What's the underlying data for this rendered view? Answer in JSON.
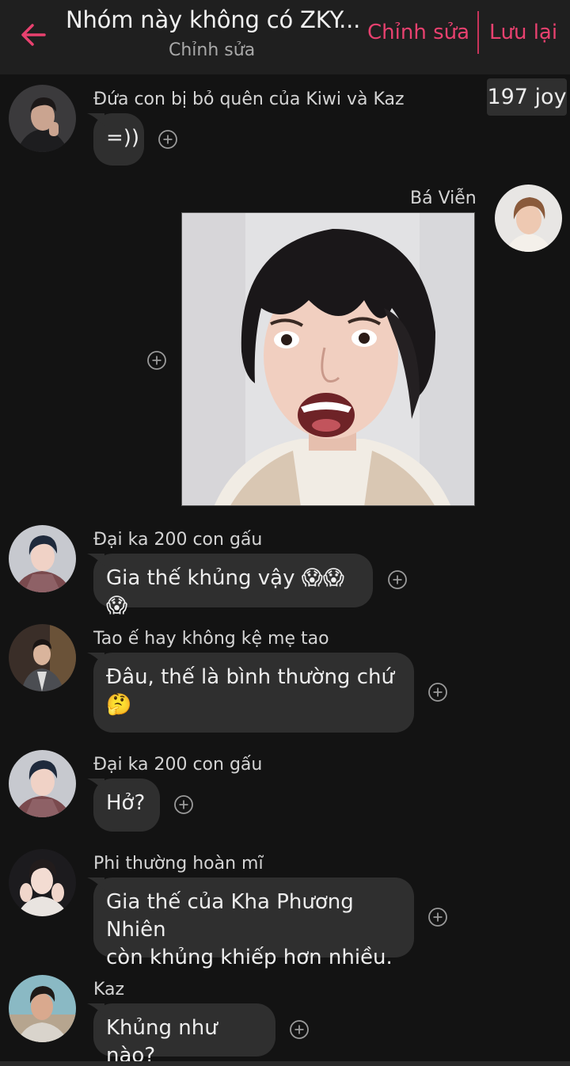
{
  "header": {
    "title": "Nhóm này không có ZKY...",
    "subtitle": "Chỉnh sửa",
    "edit_label": "Chỉnh sửa",
    "save_label": "Lưu lại"
  },
  "joy_badge": "197 joy",
  "accent_color": "#e8416f",
  "messages": [
    {
      "sender": "Đứa con bị bỏ quên của Kiwi và Kaz",
      "text": "=))",
      "side": "left"
    },
    {
      "sender": "Bá Viễn",
      "type": "image",
      "image_label": "surprised-face-photo",
      "side": "right"
    },
    {
      "sender": "Đại ka 200 con gấu",
      "text": "Gia thế khủng vậy 😱😱😱",
      "side": "left"
    },
    {
      "sender": "Tao ế hay không kệ mẹ tao",
      "text_line1": "Đâu, thế là bình thường chứ",
      "text_line2": "🤔",
      "side": "left"
    },
    {
      "sender": "Đại ka 200 con gấu",
      "text": "Hở?",
      "side": "left"
    },
    {
      "sender": "Phi thường hoàn mĩ",
      "text_line1": "Gia thế của Kha Phương Nhiên",
      "text_line2": "còn khủng khiếp hơn nhiều.",
      "side": "left"
    },
    {
      "sender": "Kaz",
      "text": "Khủng như nào?",
      "side": "left"
    }
  ],
  "icons": {
    "back": "arrow-left-icon",
    "react": "plus-circle-icon"
  }
}
